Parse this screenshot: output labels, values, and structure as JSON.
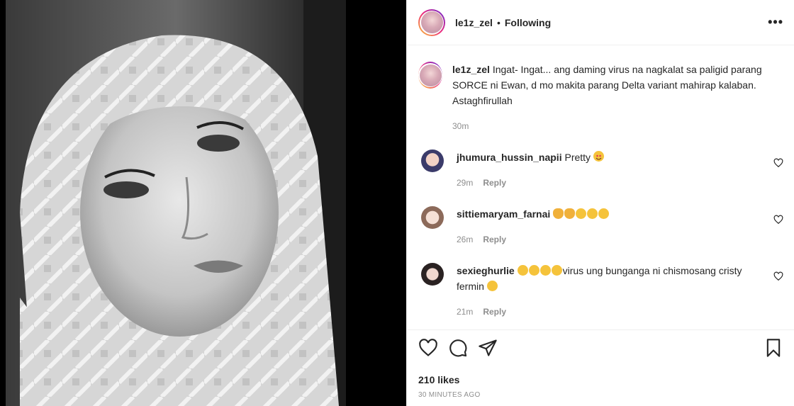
{
  "post": {
    "username": "le1z_zel",
    "dot": "•",
    "following_label": "Following",
    "more_label": "•••"
  },
  "caption": {
    "username": "le1z_zel",
    "text": "Ingat- Ingat... ang daming virus na nagkalat sa paligid parang SORCE ni Ewan, d mo makita parang Delta variant mahirap kalaban. Astaghfirullah",
    "time": "30m"
  },
  "comments": [
    {
      "username": "jhumura_hussin_napii",
      "text": "Pretty ",
      "time": "29m",
      "reply": "Reply",
      "emoji": [
        "heart-eyes"
      ]
    },
    {
      "username": "sittiemaryam_farnai",
      "text": "",
      "time": "26m",
      "reply": "Reply",
      "emoji": [
        "clap",
        "clap",
        "rofl",
        "rofl",
        "rofl"
      ]
    },
    {
      "username": "sexieghurlie",
      "text": "virus ung bunganga ni chismosang cristy fermin ",
      "time": "21m",
      "reply": "Reply",
      "emoji": [
        "joy",
        "joy",
        "joy",
        "joy"
      ]
    }
  ],
  "footer": {
    "likes": "210 likes",
    "timestamp": "30 MINUTES AGO"
  },
  "colors": {
    "text": "#262626",
    "muted": "#8e8e8e",
    "divider": "#efefef"
  }
}
